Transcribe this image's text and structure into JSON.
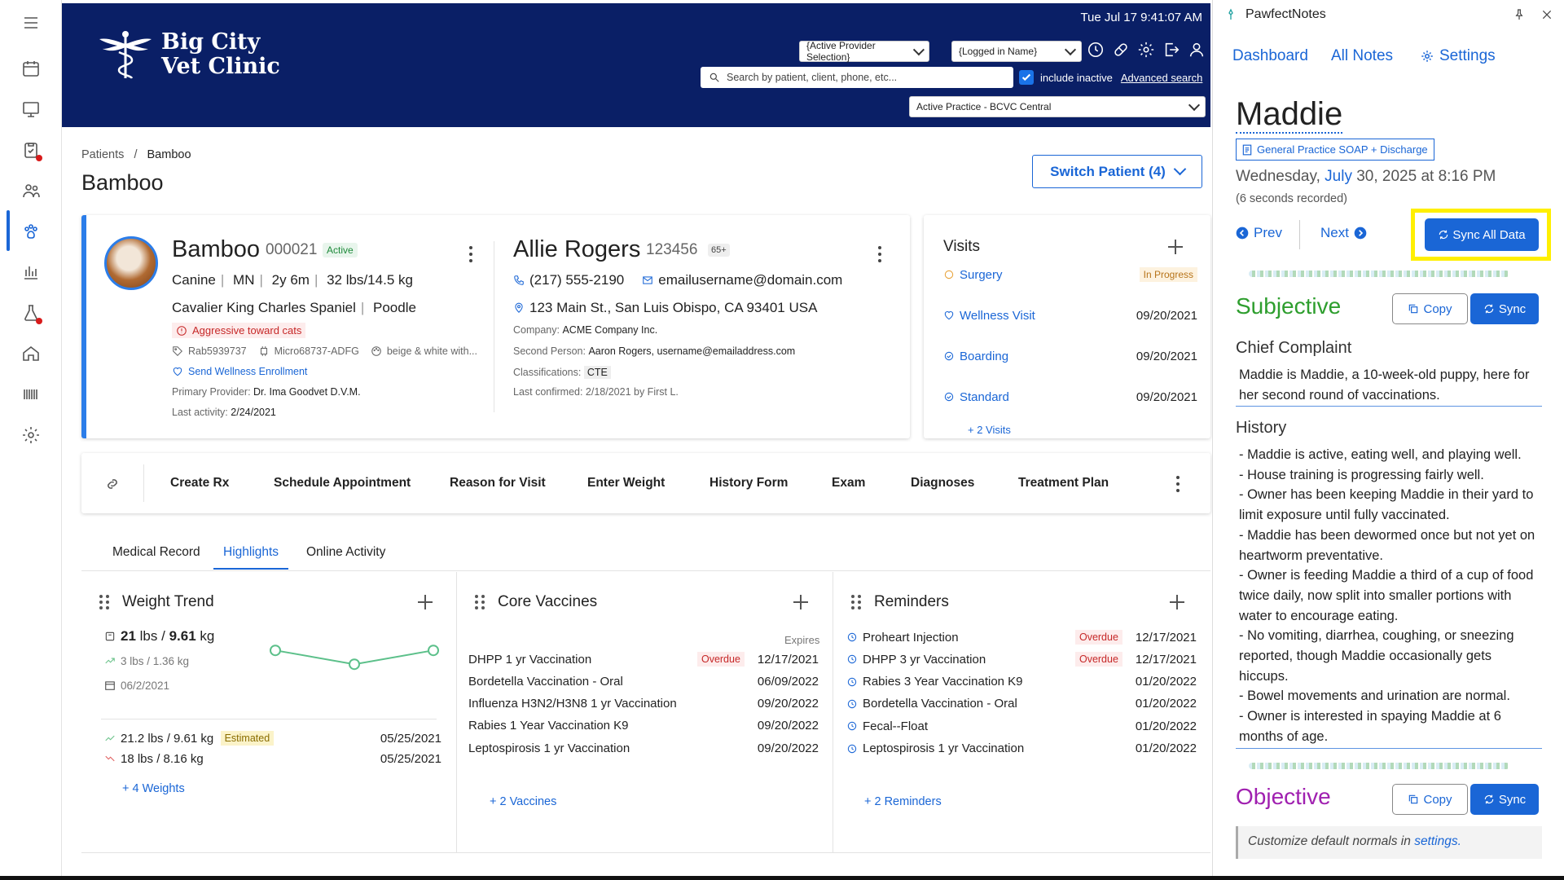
{
  "header": {
    "clinic_name_line1": "Big City",
    "clinic_name_line2": "Vet Clinic",
    "datetime": "Tue Jul 17 9:41:07 AM",
    "provider_select": "{Active Provider Selection}",
    "login_select": "{Logged in Name}",
    "search_placeholder": "Search by patient, client, phone, etc...",
    "include_inactive": "include inactive",
    "advanced_search": "Advanced search",
    "practice_select": "Active Practice - BCVC Central"
  },
  "breadcrumb": {
    "root": "Patients",
    "sep": "/",
    "current": "Bamboo"
  },
  "page_title": "Bamboo",
  "switch_patient": "Switch Patient (4)",
  "patient": {
    "name": "Bamboo",
    "id": "000021",
    "status": "Active",
    "species": "Canine",
    "sex": "MN",
    "age": "2y 6m",
    "weight": "32 lbs/14.5 kg",
    "breed1": "Cavalier King Charles Spaniel",
    "breed2": "Poodle",
    "alert": "Aggressive toward cats",
    "rabies": "Rab5939737",
    "microchip": "Micro68737-ADFG",
    "color": "beige & white with...",
    "wellness_link": "Send Wellness Enrollment",
    "primary_label": "Primary Provider:",
    "primary_value": "Dr. Ima Goodvet D.V.M.",
    "activity_label": "Last activity:",
    "activity_value": "2/24/2021"
  },
  "client": {
    "name": "Allie Rogers",
    "id": "123456",
    "age_tag": "65+",
    "phone": "(217) 555-2190",
    "email": "emailusername@domain.com",
    "address": "123 Main St., San Luis Obispo, CA 93401 USA",
    "company_label": "Company:",
    "company_value": "ACME Company Inc.",
    "second_label": "Second Person:",
    "second_value": "Aaron Rogers, username@emailaddress.com",
    "class_label": "Classifications:",
    "class_value": "CTE",
    "confirmed": "Last confirmed: 2/18/2021 by First L."
  },
  "visits": {
    "title": "Visits",
    "items": [
      {
        "name": "Surgery",
        "date": "In Progress"
      },
      {
        "name": "Wellness Visit",
        "date": "09/20/2021"
      },
      {
        "name": "Boarding",
        "date": "09/20/2021"
      },
      {
        "name": "Standard",
        "date": "09/20/2021"
      }
    ],
    "more": "+ 2 Visits"
  },
  "actions": [
    "Create Rx",
    "Schedule Appointment",
    "Reason for Visit",
    "Enter Weight",
    "History Form",
    "Exam",
    "Diagnoses",
    "Treatment Plan"
  ],
  "tabs": [
    "Medical Record",
    "Highlights",
    "Online Activity"
  ],
  "weight": {
    "title": "Weight Trend",
    "current_lbs": "21",
    "current_sep": "lbs /",
    "current_kg": "9.61",
    "current_unit": "kg",
    "change": "3 lbs / 1.36 kg",
    "date": "06/2/2021",
    "trend": [
      0.7,
      0.2,
      0.7
    ],
    "rows": [
      {
        "value": "21.2 lbs / 9.61 kg",
        "tag": "Estimated",
        "date": "05/25/2021"
      },
      {
        "value": "18 lbs / 8.16 kg",
        "tag": "",
        "date": "05/25/2021"
      }
    ],
    "more": "+ 4 Weights"
  },
  "vaccines": {
    "title": "Core Vaccines",
    "expires": "Expires",
    "items": [
      {
        "name": "DHPP 1 yr Vaccination",
        "tag": "Overdue",
        "date": "12/17/2021"
      },
      {
        "name": "Bordetella Vaccination - Oral",
        "tag": "",
        "date": "06/09/2022"
      },
      {
        "name": "Influenza H3N2/H3N8 1 yr Vaccination",
        "tag": "",
        "date": "09/20/2022"
      },
      {
        "name": "Rabies 1 Year Vaccination K9",
        "tag": "",
        "date": "09/20/2022"
      },
      {
        "name": "Leptospirosis 1 yr Vaccination",
        "tag": "",
        "date": "09/20/2022"
      }
    ],
    "more": "+ 2 Vaccines"
  },
  "reminders": {
    "title": "Reminders",
    "items": [
      {
        "name": "Proheart Injection",
        "tag": "Overdue",
        "date": "12/17/2021"
      },
      {
        "name": "DHPP 3 yr Vaccination",
        "tag": "Overdue",
        "date": "12/17/2021"
      },
      {
        "name": "Rabies 3 Year Vaccination K9",
        "tag": "",
        "date": "01/20/2022"
      },
      {
        "name": "Bordetella Vaccination - Oral",
        "tag": "",
        "date": "01/20/2022"
      },
      {
        "name": "Fecal--Float",
        "tag": "",
        "date": "01/20/2022"
      },
      {
        "name": "Leptospirosis 1 yr Vaccination",
        "tag": "",
        "date": "01/20/2022"
      }
    ],
    "more": "+ 2 Reminders"
  },
  "sidebar": {
    "app_name": "PawfectNotes",
    "nav": [
      "Dashboard",
      "All Notes",
      "Settings"
    ],
    "patient_name": "Maddie",
    "template": "General Practice SOAP + Discharge",
    "date_pre": "Wednesday,",
    "date_month": "July",
    "date_post": "30, 2025 at 8:16 PM",
    "recorded": "(6 seconds recorded)",
    "prev": "Prev",
    "next": "Next",
    "sync_all": "Sync All Data",
    "copy": "Copy",
    "sync": "Sync",
    "subjective": "Subjective",
    "chief_title": "Chief Complaint",
    "chief_text": "Maddie is Maddie, a 10-week-old puppy, here for her second round of vaccinations.",
    "history_title": "History",
    "history": [
      "- Maddie is active, eating well, and playing well.",
      "- House training is progressing fairly well.",
      "- Owner has been keeping Maddie in their yard to limit exposure until fully vaccinated.",
      "- Maddie has been dewormed once but not yet on heartworm preventative.",
      "- Owner is feeding Maddie a third of a cup of food twice daily, now split into smaller portions with water to encourage eating.",
      "- No vomiting, diarrhea, coughing, or sneezing reported, though Maddie occasionally gets hiccups.",
      "- Bowel movements and urination are normal.",
      "- Owner is interested in spaying Maddie at 6 months of age."
    ],
    "objective": "Objective",
    "note_pre": "Customize default normals in",
    "note_link": "settings."
  },
  "colors": {
    "header": "#0a1f66",
    "accent": "#1a66d6",
    "subjective": "#2e9e2e",
    "objective": "#a020b0",
    "highlight": "#ffef00"
  }
}
